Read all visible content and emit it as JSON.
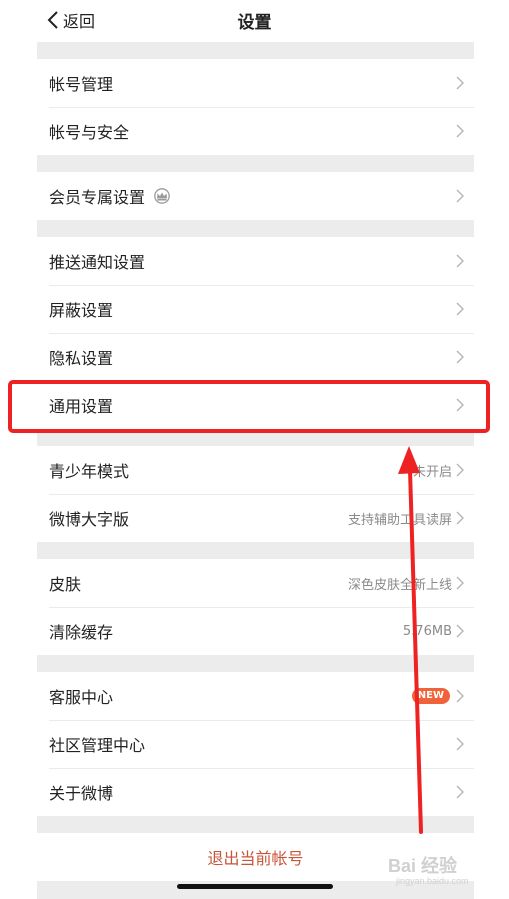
{
  "header": {
    "back_label": "返回",
    "title": "设置"
  },
  "groups": [
    {
      "rows": [
        {
          "label": "帐号管理"
        },
        {
          "label": "帐号与安全"
        }
      ]
    },
    {
      "rows": [
        {
          "label": "会员专属设置"
        }
      ]
    },
    {
      "rows": [
        {
          "label": "推送通知设置"
        },
        {
          "label": "屏蔽设置"
        },
        {
          "label": "隐私设置"
        },
        {
          "label": "通用设置"
        }
      ]
    },
    {
      "rows": [
        {
          "label": "青少年模式",
          "value": "未开启"
        },
        {
          "label": "微博大字版",
          "value": "支持辅助工具读屏"
        }
      ]
    },
    {
      "rows": [
        {
          "label": "皮肤",
          "value": "深色皮肤全新上线"
        },
        {
          "label": "清除缓存",
          "value": "5.76MB"
        }
      ]
    },
    {
      "rows": [
        {
          "label": "客服中心",
          "badge": "NEW"
        },
        {
          "label": "社区管理中心"
        },
        {
          "label": "关于微博"
        }
      ]
    }
  ],
  "logout_label": "退出当前帐号",
  "watermark": {
    "main": "Bai 经验",
    "sub": "jingyan.baidu.com"
  },
  "colors": {
    "highlight": "#ee2222",
    "logout_text": "#c8543a",
    "badge": "#f0623a"
  }
}
